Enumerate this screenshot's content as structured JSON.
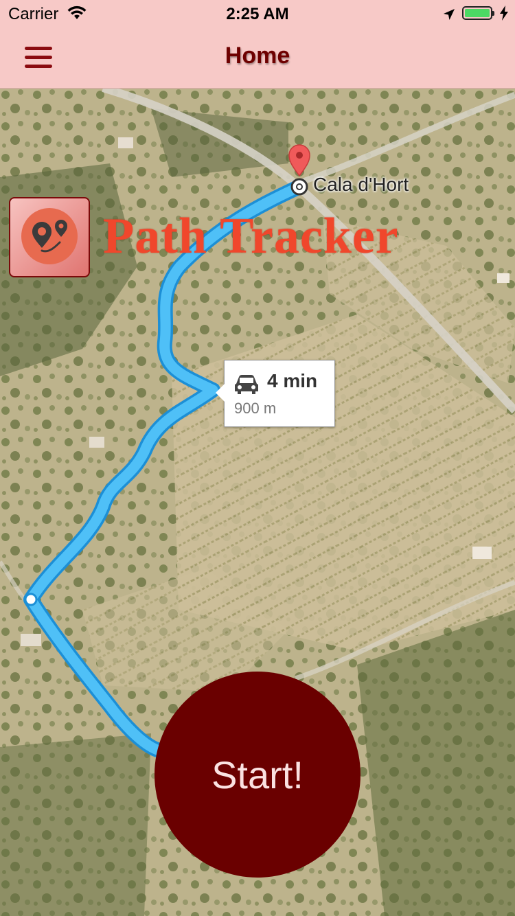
{
  "status_bar": {
    "carrier": "Carrier",
    "time": "2:25 AM",
    "wifi_icon": "wifi-icon",
    "location_icon": "location-arrow-icon",
    "battery_icon": "battery-icon",
    "charging_icon": "bolt-icon"
  },
  "nav": {
    "title": "Home",
    "menu_icon": "hamburger-menu-icon"
  },
  "app": {
    "name": "Path Tracker",
    "logo_icon": "path-pins-icon"
  },
  "map": {
    "destination_label": "Cala d'Hort",
    "route_duration": "4 min",
    "route_distance": "900 m",
    "route_color": "#3bb4f2",
    "destination_pin_color": "#f05a5a",
    "travel_mode_icon": "car-icon"
  },
  "actions": {
    "start_label": "Start!"
  },
  "colors": {
    "header_bg": "#f7c9c7",
    "accent": "#6a0000",
    "title_color": "#f0472c"
  }
}
